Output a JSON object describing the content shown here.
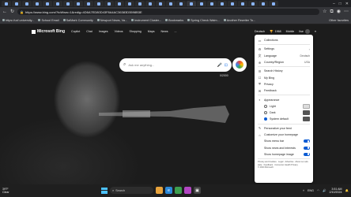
{
  "address": {
    "url": "https://www.bing.com/?toWww=1&redig=4D6A7ED80D43F8A4AC36383D5598B3E"
  },
  "bookmarks": [
    "https://ucf.university...",
    "School Email",
    "SalMark Community",
    "Newport News, Va...",
    "Instrument Cluster...",
    "Bookmarks",
    "Spring Check Walm...",
    "Another Rewriter To...",
    "Other favorites"
  ],
  "bing": {
    "brand": "Microsoft Bing",
    "nav": [
      "Copilot",
      "Chat",
      "Images",
      "Videos",
      "Shopping",
      "Maps",
      "News",
      "..."
    ],
    "right_nav": [
      "Deutsch",
      "Rewards",
      "Mobile",
      "Ilse"
    ],
    "rewards_count": "1968",
    "search_placeholder": "Ask me anything...",
    "char_counter": "0/2000"
  },
  "panel": {
    "items": [
      {
        "icon": "▭",
        "label": "Collections"
      },
      {
        "icon": "⚙",
        "label": "Settings",
        "chevron": true
      },
      {
        "icon": "文",
        "label": "Language",
        "value": "Deutsch"
      },
      {
        "icon": "⊕",
        "label": "Country/Region",
        "value": "USA"
      }
    ],
    "items2": [
      {
        "icon": "☰",
        "label": "Search History"
      },
      {
        "icon": "☐",
        "label": "My Bing"
      },
      {
        "icon": "⛨",
        "label": "Privacy"
      },
      {
        "icon": "✉",
        "label": "Feedback"
      }
    ],
    "appearance_label": "Appearance",
    "themes": [
      "Light",
      "Dark",
      "System default"
    ],
    "personalize_label": "Personalize your feed",
    "customize_label": "Customize your homepage",
    "toggles": [
      "Show menu bar",
      "Show news and interests",
      "Show homepage image"
    ],
    "footer_text": "Privacy and Cookies · Legal · Advertise · About our ads · Help · Feedback · Consumer Health Privacy",
    "copyright": "© 2024 Microsoft"
  },
  "taskbar": {
    "temperature": "39°F",
    "condition": "Clear",
    "search_label": "Search",
    "time": "3:51 AM",
    "date": "2/10/2024",
    "lang": "ENG"
  }
}
